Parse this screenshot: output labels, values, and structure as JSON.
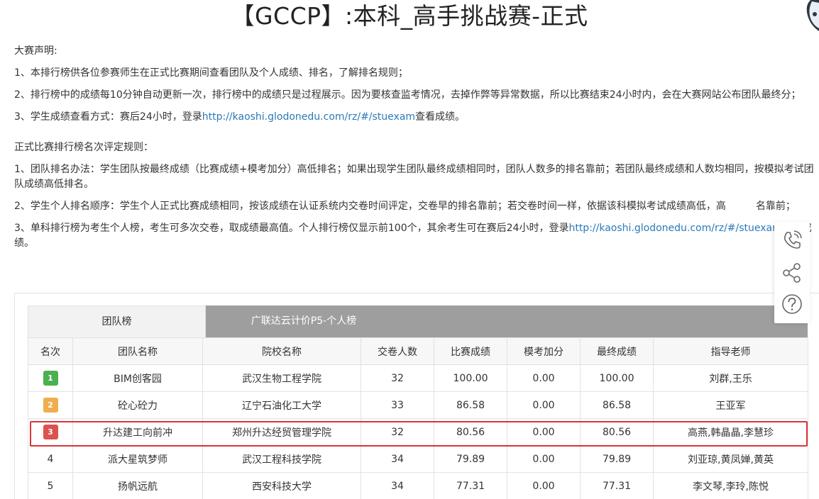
{
  "page": {
    "title": "【GCCP】:本科_高手挑战赛-正式"
  },
  "notice": {
    "heading": "大赛声明:",
    "items": [
      "1、本排行榜供各位参赛师生在正式比赛期间查看团队及个人成绩、排名，了解排名规则；",
      "2、排行榜中的成绩每10分钟自动更新一次，排行榜中的成绩只是过程展示。因为要核查监考情况，去掉作弊等异常数据，所以比赛结束24小时内，会在大赛网站公布团队最终分；"
    ],
    "item3_prefix": "3、学生成绩查看方式：赛后24小时，登录",
    "item3_link": "http://kaoshi.glodonedu.com/rz/#/stuexam",
    "item3_suffix": "查看成绩。",
    "rules_heading": "正式比赛排行榜名次评定规则：",
    "rules": [
      "1、团队排名办法：学生团队按最终成绩（比赛成绩+模考加分）高低排名；如果出现学生团队最终成绩相同时，团队人数多的排名靠前；若团队最终成绩和人数均相同，按模拟考试团队成绩高低排名。",
      "2、学生个人排名顺序：学生个人正式比赛成绩相同，按该成绩在认证系统内交卷时间评定，交卷早的排名靠前；若交卷时间一样，依据该科模拟考试成绩高低，高　　　名靠前；"
    ],
    "rule3_prefix": "3、单科排行榜为考生个人榜，考生可多次交卷，取成绩最高值。个人排行榜仅显示前100个，其余考生可在赛后24小时，登录",
    "rule3_link": "http://kaoshi.glodonedu.com/rz/#/stuexam",
    "rule3_suffix": "查看成绩。"
  },
  "tabs": {
    "team": "团队榜",
    "individual": "广联达云计价P5-个人榜"
  },
  "table": {
    "headers": [
      "名次",
      "团队名称",
      "院校名称",
      "交卷人数",
      "比赛成绩",
      "模考加分",
      "最终成绩",
      "指导老师"
    ],
    "rows": [
      {
        "rank": "1",
        "team": "BIM创客园",
        "school": "武汉生物工程学院",
        "count": "32",
        "score": "100.00",
        "bonus": "0.00",
        "final": "100.00",
        "teacher": "刘群,王乐"
      },
      {
        "rank": "2",
        "team": "砼心砼力",
        "school": "辽宁石油化工大学",
        "count": "33",
        "score": "86.58",
        "bonus": "0.00",
        "final": "86.58",
        "teacher": "王亚军"
      },
      {
        "rank": "3",
        "team": "升达建工向前冲",
        "school": "郑州升达经贸管理学院",
        "count": "32",
        "score": "80.56",
        "bonus": "0.00",
        "final": "80.56",
        "teacher": "高燕,韩晶晶,李慧珍"
      },
      {
        "rank": "4",
        "team": "派大星筑梦师",
        "school": "武汉工程科技学院",
        "count": "34",
        "score": "79.89",
        "bonus": "0.00",
        "final": "79.89",
        "teacher": "刘亚琼,黄凤婵,黄英"
      },
      {
        "rank": "5",
        "team": "扬帆远航",
        "school": "西安科技大学",
        "count": "34",
        "score": "77.31",
        "bonus": "0.00",
        "final": "77.31",
        "teacher": "李文琴,李玲,陈悦"
      }
    ]
  },
  "colors": {
    "rank1": "#4caf50",
    "rank2": "#f0ad4e",
    "rank3": "#d9534f",
    "highlight": "#d9343b",
    "link": "#2a7ab8"
  },
  "icons": {
    "float": [
      "phone-icon",
      "share-icon",
      "help-icon"
    ]
  }
}
